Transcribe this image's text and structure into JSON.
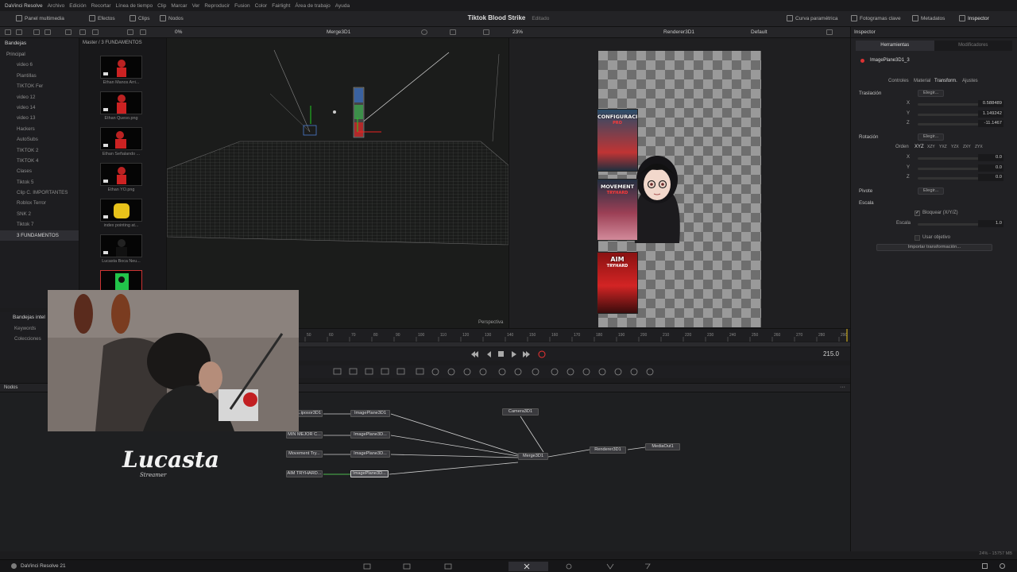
{
  "menubar": {
    "app": "DaVinci Resolve",
    "items": [
      "Archivo",
      "Edición",
      "Recortar",
      "Línea de tiempo",
      "Clip",
      "Marcar",
      "Ver",
      "Reproducir",
      "Fusion",
      "Color",
      "Fairlight",
      "Área de trabajo",
      "Ayuda"
    ]
  },
  "toolbar": {
    "left": [
      "Panel multimedia",
      "Efectos",
      "Clips",
      "Nodos"
    ],
    "project_name": "Tiktok Blood Strike",
    "project_state": "Editado",
    "right": [
      "Curva paramétrica",
      "Fotogramas clave",
      "Metadatos",
      "Inspector"
    ]
  },
  "viewer_header": {
    "zoom_left": "0%",
    "viewer1_name": "Merge3D1",
    "zoom_right": "23%",
    "viewer2_name": "Renderer3D1",
    "view_mode": "Default"
  },
  "bins": {
    "title": "Bandejas",
    "root": "Principal",
    "items": [
      "video 6",
      "Plantillas",
      "TIKTOK Fer",
      "video 12",
      "video 14",
      "video 13",
      "Hackers",
      "AutoSubs",
      "TIKTOK 2",
      "TIKTOK 4",
      "Clases",
      "Tiktok 5",
      "Clip C. IMPORTANTES",
      "Roblox Terror",
      "SNK 2",
      "Tiktok 7",
      "3 FUNDAMENTOS"
    ],
    "selected": "3 FUNDAMENTOS"
  },
  "media": {
    "path": "Master / 3 FUNDAMENTOS",
    "clips": [
      "Ethan Manos Arri...",
      "Ethan Queso.png",
      "Ethan Señalando ...",
      "Ethan YO.png",
      "index pointing at...",
      "Lucasta Boca Neu...",
      ""
    ]
  },
  "smart_bins": {
    "title": "Bandejas intel",
    "items": [
      "Keywords",
      "Colecciones"
    ]
  },
  "viewer1": {
    "label": "Perspectiva"
  },
  "viewer2": {
    "posters": [
      {
        "title": "CONFIGURACIÓN",
        "subtitle": "PRO"
      },
      {
        "title": "MOVEMENT",
        "subtitle": "TRYHARD"
      },
      {
        "title": "AIM",
        "subtitle": "TRYHARD"
      }
    ]
  },
  "timeline": {
    "ticks": [
      "50",
      "60",
      "70",
      "80",
      "90",
      "100",
      "110",
      "120",
      "130",
      "140",
      "150",
      "160",
      "170",
      "180",
      "190",
      "200",
      "210",
      "220",
      "230",
      "240",
      "250",
      "260",
      "270",
      "280",
      "290"
    ],
    "current_frame": "215.0"
  },
  "nodes_panel": {
    "title": "Nodos",
    "nodes": {
      "src1": "...iposor3D1",
      "src2": "MIN MEJOR C...",
      "src3": "Movement Try...",
      "src4": "AIM TRYHARD...",
      "img1": "ImagePlane3D1",
      "img2": "ImagePlane3D...",
      "img3": "ImagePlane3D...",
      "img4": "ImagePlane3D...",
      "camera": "Camera3D1",
      "merge": "Merge3D1",
      "renderer": "Renderer3D1",
      "mediaout": "MediaOut1"
    }
  },
  "inspector": {
    "title": "Inspector",
    "tabs": [
      "Herramientas",
      "Modificadores"
    ],
    "node_name": "ImagePlane3D1_3",
    "subtabs": [
      "Controles",
      "Material",
      "Transform.",
      "Ajustes"
    ],
    "active_subtab": "Transform.",
    "translation": {
      "label": "Traslación",
      "pick": "Elegir...",
      "x_label": "X",
      "x": "0.588489",
      "y_label": "Y",
      "y": "1.149242",
      "z_label": "Z",
      "z": "-11.1467"
    },
    "rotation": {
      "label": "Rotación",
      "pick": "Elegir...",
      "order_label": "Orden",
      "orders": [
        "XYZ",
        "XZY",
        "YXZ",
        "YZX",
        "ZXY",
        "ZYX"
      ],
      "x_label": "X",
      "x": "0.0",
      "y_label": "Y",
      "y": "0.0",
      "z_label": "Z",
      "z": "0.0"
    },
    "pivot": {
      "label": "Pivote",
      "pick": "Elegir..."
    },
    "scale": {
      "label": "Escala",
      "lock_label": "Bloquear (X/Y/Z)",
      "value_label": "Escala",
      "value": "1.0"
    },
    "target_label": "Usar objetivo",
    "import_button": "Importar transformación..."
  },
  "status": {
    "memory": "24% - 15757 MB"
  },
  "pagebar": {
    "app": "DaVinci Resolve 21"
  },
  "overlay": {
    "brand": "Lucasta",
    "brand_sub": "Streamer"
  }
}
